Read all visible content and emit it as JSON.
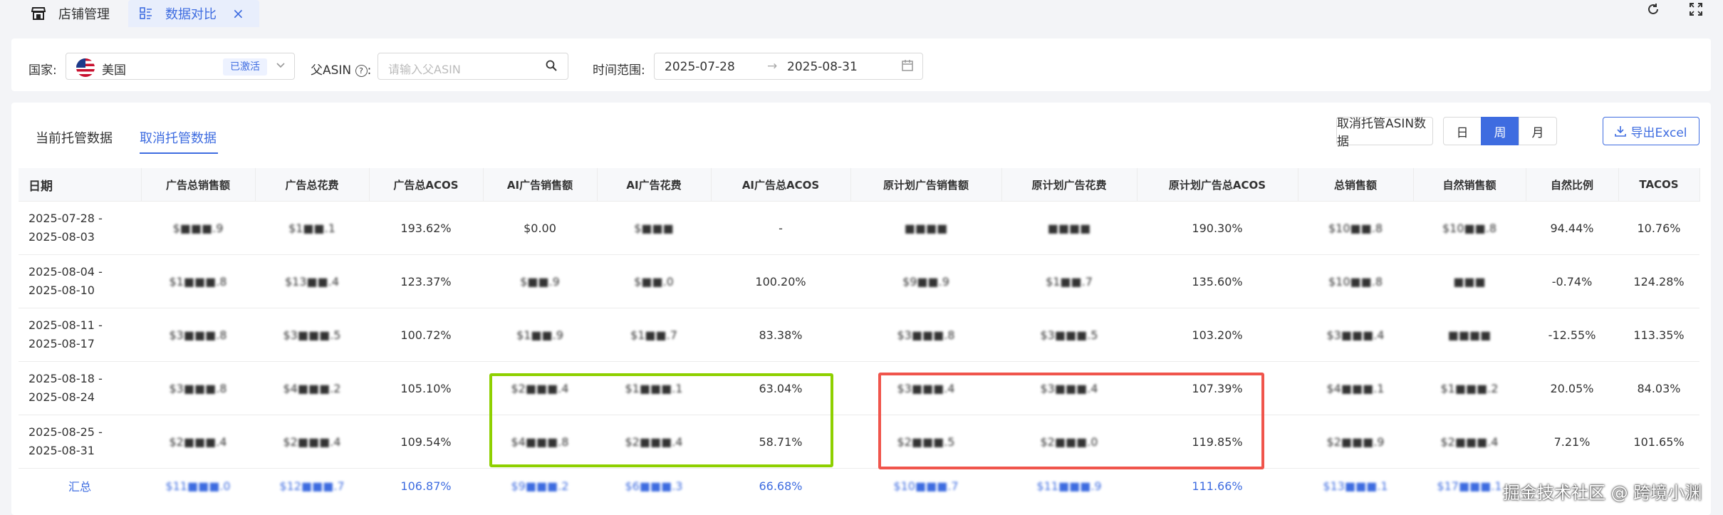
{
  "tabs": [
    {
      "label": "店铺管理",
      "icon": "store-icon"
    },
    {
      "label": "数据对比",
      "icon": "dashboard-icon",
      "active": true
    }
  ],
  "filters": {
    "country_label": "国家:",
    "country_value": "美国",
    "country_badge": "已激活",
    "parent_asin_label": "父ASIN",
    "parent_asin_placeholder": "请输入父ASIN",
    "date_label": "时间范围:",
    "date_start": "2025-07-28",
    "date_end": "2025-08-31"
  },
  "view_tabs": [
    {
      "label": "当前托管数据",
      "active": false
    },
    {
      "label": "取消托管数据",
      "active": true
    }
  ],
  "toolbar": {
    "cancel_asin_data": "取消托管ASIN数据",
    "granularity": [
      {
        "label": "日",
        "active": false
      },
      {
        "label": "周",
        "active": true
      },
      {
        "label": "月",
        "active": false
      }
    ],
    "export_label": "导出Excel"
  },
  "table": {
    "columns": [
      "日期",
      "广告总销售额",
      "广告总花费",
      "广告总ACOS",
      "AI广告销售额",
      "AI广告花费",
      "AI广告总ACOS",
      "原计划广告销售额",
      "原计划广告花费",
      "原计划广告总ACOS",
      "总销售额",
      "自然销售额",
      "自然比例",
      "TACOS"
    ],
    "rows": [
      {
        "date1": "2025-07-28 -",
        "date2": "2025-08-03",
        "cells": [
          "$■■■.9",
          "$1■■.1",
          "193.62%",
          "$0.00",
          "$■■■",
          "-",
          "■■■■",
          "■■■■",
          "190.30%",
          "$10■■.8",
          "$10■■.8",
          "94.44%",
          "10.76%"
        ]
      },
      {
        "date1": "2025-08-04 -",
        "date2": "2025-08-10",
        "cells": [
          "$1■■■.8",
          "$13■■.4",
          "123.37%",
          "$■■.9",
          "$■■.0",
          "100.20%",
          "$9■■.9",
          "$1■■.7",
          "135.60%",
          "$10■■.8",
          "■■■",
          "-0.74%",
          "124.28%"
        ]
      },
      {
        "date1": "2025-08-11 -",
        "date2": "2025-08-17",
        "cells": [
          "$3■■■.8",
          "$3■■■.5",
          "100.72%",
          "$1■■.9",
          "$1■■.7",
          "83.38%",
          "$3■■■.8",
          "$3■■■.5",
          "103.20%",
          "$3■■■.4",
          "■■■■",
          "-12.55%",
          "113.35%"
        ]
      },
      {
        "date1": "2025-08-18 -",
        "date2": "2025-08-24",
        "cells": [
          "$3■■■.8",
          "$4■■■.2",
          "105.10%",
          "$2■■■.4",
          "$1■■■.1",
          "63.04%",
          "$3■■■.4",
          "$3■■■.4",
          "107.39%",
          "$4■■■.1",
          "$1■■■.2",
          "20.05%",
          "84.03%"
        ]
      },
      {
        "date1": "2025-08-25 -",
        "date2": "2025-08-31",
        "cells": [
          "$2■■■.4",
          "$2■■■.4",
          "109.54%",
          "$4■■■.8",
          "$2■■■.4",
          "58.71%",
          "$2■■■.5",
          "$2■■■.0",
          "119.85%",
          "$2■■■.9",
          "$2■■■.4",
          "7.21%",
          "101.65%"
        ]
      }
    ],
    "total": {
      "label": "汇总",
      "cells": [
        "$11■■■.0",
        "$12■■■.7",
        "106.87%",
        "$9■■■.2",
        "$6■■■.3",
        "66.68%",
        "$10■■■.7",
        "$11■■■.9",
        "111.66%",
        "$13■■■.1",
        "$17■■■.1",
        "",
        ""
      ]
    },
    "blurred_column_indexes": [
      0,
      1,
      3,
      4,
      6,
      7,
      9,
      10
    ]
  },
  "colors": {
    "accent": "#3e6ce0",
    "highlight_green": "#8ed000",
    "highlight_red": "#f0554c"
  },
  "watermark": "掘金技术社区 @ 跨境小渊"
}
